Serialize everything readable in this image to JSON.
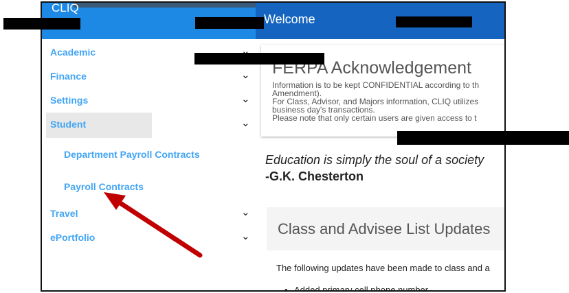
{
  "header": {
    "app_title": "CLIQ",
    "welcome": "Welcome"
  },
  "sidebar": {
    "items": [
      {
        "label": "Academic"
      },
      {
        "label": "Finance"
      },
      {
        "label": "Settings"
      },
      {
        "label": "Student",
        "active": true
      },
      {
        "label": "Travel"
      },
      {
        "label": "ePortfolio"
      }
    ],
    "sub_items": [
      {
        "label": "Department Payroll Contracts"
      },
      {
        "label": "Payroll Contracts"
      }
    ]
  },
  "main": {
    "ferpa": {
      "title": "FERPA Acknowledgement",
      "lines": [
        "Information is to be kept CONFIDENTIAL according to th",
        "Amendment).",
        "For Class, Advisor, and Majors information, CLIQ utilizes",
        "business day's transactions.",
        "Please note that only certain users are given access to t"
      ]
    },
    "quote": {
      "text": "Education is simply the soul of a society",
      "author": "-G.K. Chesterton"
    },
    "updates": {
      "title": "Class and Advisee List Updates",
      "intro": "The following updates have been made to class and a",
      "items": [
        "Added primary cell phone number"
      ]
    }
  },
  "colors": {
    "sidebar_header": "#1e88e5",
    "main_header": "#1565c0",
    "nav_link": "#42a5f5",
    "active_highlight": "#e8e8e8",
    "annotation_arrow": "#c00000"
  },
  "icons": {
    "expand": "chevron-down-icon"
  }
}
